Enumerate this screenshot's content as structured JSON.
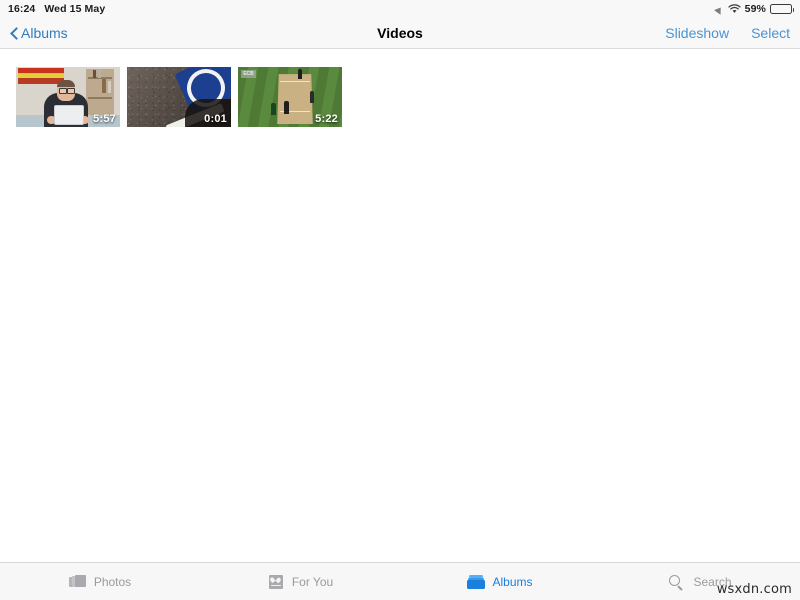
{
  "status_bar": {
    "time": "16:24",
    "date": "Wed 15 May",
    "battery_percent": "59%",
    "icons": [
      "location-icon",
      "wifi-icon",
      "battery-icon"
    ]
  },
  "nav_bar": {
    "back_label": "Albums",
    "title": "Videos",
    "slideshow_label": "Slideshow",
    "select_label": "Select",
    "accent_color": "#2f7cc0"
  },
  "grid": {
    "items": [
      {
        "name": "video-thumbnail-1",
        "duration": "5:57",
        "description": "person with glasses holding a tablet in front of bookshelf"
      },
      {
        "name": "video-thumbnail-2",
        "duration": "0:01",
        "description": "asphalt road surface with blue road sign"
      },
      {
        "name": "video-thumbnail-3",
        "duration": "5:22",
        "badge": "ECB",
        "description": "cricket pitch with players on green field"
      }
    ]
  },
  "tab_bar": {
    "tabs": [
      {
        "label": "Photos",
        "icon": "photos-icon",
        "active": false
      },
      {
        "label": "For You",
        "icon": "for-you-icon",
        "active": false
      },
      {
        "label": "Albums",
        "icon": "albums-icon",
        "active": true
      },
      {
        "label": "Search",
        "icon": "search-icon",
        "active": false
      }
    ],
    "active_color": "#1b7fe0",
    "inactive_color": "#9a9a9f"
  },
  "watermark": {
    "text": "wsxdn.com"
  }
}
